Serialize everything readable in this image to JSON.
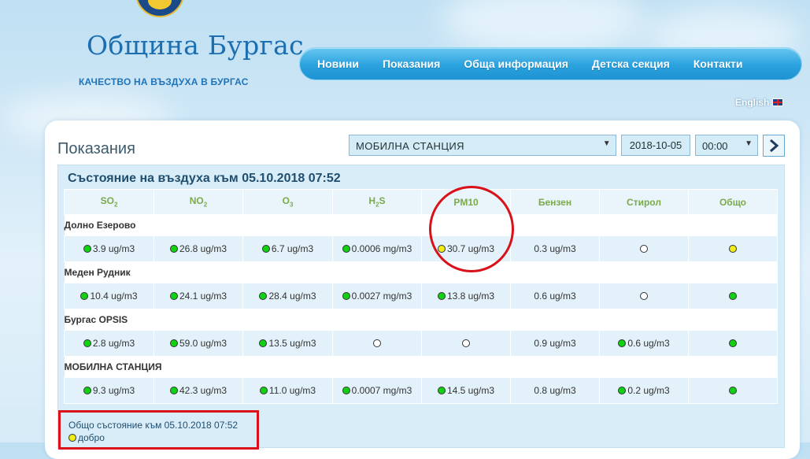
{
  "brand": {
    "title": "Община Бургас",
    "subtitle": "КАЧЕСТВО НА ВЪЗДУХА В БУРГАС"
  },
  "nav": {
    "items": [
      "Новини",
      "Показания",
      "Обща информация",
      "Детска секция",
      "Контакти"
    ]
  },
  "language": {
    "label": "English"
  },
  "page": {
    "title": "Показания"
  },
  "controls": {
    "station": "МОБИЛНА СТАНЦИЯ",
    "date": "2018-10-05",
    "time": "00:00"
  },
  "status_heading": "Състояние на въздуха към 05.10.2018 07:52",
  "columns": [
    {
      "base": "SO",
      "sub": "2"
    },
    {
      "base": "NO",
      "sub": "2"
    },
    {
      "base": "O",
      "sub": "3"
    },
    {
      "base": "H",
      "sub": "2",
      "tail": "S"
    },
    {
      "base": "PM10"
    },
    {
      "base": "Бензен"
    },
    {
      "base": "Стирол"
    },
    {
      "base": "Общо"
    }
  ],
  "stations": [
    {
      "name": "Долно Езерово",
      "cells": [
        {
          "status": "green",
          "value": "3.9 ug/m3"
        },
        {
          "status": "green",
          "value": "26.8 ug/m3"
        },
        {
          "status": "green",
          "value": "6.7 ug/m3"
        },
        {
          "status": "green",
          "value": "0.0006 mg/m3"
        },
        {
          "status": "yellow",
          "value": "30.7 ug/m3"
        },
        {
          "status": "none",
          "value": "0.3 ug/m3"
        },
        {
          "status": "empty",
          "value": ""
        },
        {
          "status": "yellow",
          "value": ""
        }
      ]
    },
    {
      "name": "Меден Рудник",
      "cells": [
        {
          "status": "green",
          "value": "10.4 ug/m3"
        },
        {
          "status": "green",
          "value": "24.1 ug/m3"
        },
        {
          "status": "green",
          "value": "28.4 ug/m3"
        },
        {
          "status": "green",
          "value": "0.0027 mg/m3"
        },
        {
          "status": "green",
          "value": "13.8 ug/m3"
        },
        {
          "status": "none",
          "value": "0.6 ug/m3"
        },
        {
          "status": "empty",
          "value": ""
        },
        {
          "status": "green",
          "value": ""
        }
      ]
    },
    {
      "name": "Бургас OPSIS",
      "cells": [
        {
          "status": "green",
          "value": "2.8 ug/m3"
        },
        {
          "status": "green",
          "value": "59.0 ug/m3"
        },
        {
          "status": "green",
          "value": "13.5 ug/m3"
        },
        {
          "status": "empty",
          "value": ""
        },
        {
          "status": "empty",
          "value": ""
        },
        {
          "status": "none",
          "value": "0.9 ug/m3"
        },
        {
          "status": "green",
          "value": "0.6 ug/m3"
        },
        {
          "status": "green",
          "value": ""
        }
      ]
    },
    {
      "name": "МОБИЛНА СТАНЦИЯ",
      "cells": [
        {
          "status": "green",
          "value": "9.3 ug/m3"
        },
        {
          "status": "green",
          "value": "42.3 ug/m3"
        },
        {
          "status": "green",
          "value": "11.0 ug/m3"
        },
        {
          "status": "green",
          "value": "0.0007 mg/m3"
        },
        {
          "status": "green",
          "value": "14.5 ug/m3"
        },
        {
          "status": "none",
          "value": "0.8 ug/m3"
        },
        {
          "status": "green",
          "value": "0.2 ug/m3"
        },
        {
          "status": "green",
          "value": ""
        }
      ]
    }
  ],
  "overall": {
    "heading": "Общо състояние към 05.10.2018 07:52",
    "status": "yellow",
    "label": "добро"
  },
  "colors": {
    "green": "#11d211",
    "yellow": "#f0ec16",
    "highlight": "#d8111b",
    "nav": "#2aa2de"
  }
}
